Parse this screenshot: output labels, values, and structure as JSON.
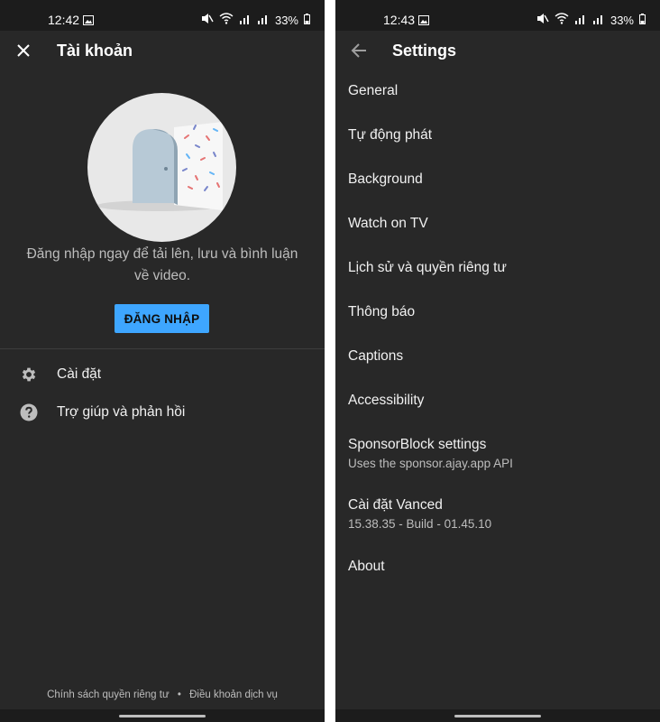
{
  "left": {
    "status": {
      "time": "12:42",
      "battery": "33%"
    },
    "appbar": {
      "title": "Tài khoản",
      "nav_icon": "close-icon"
    },
    "signin": {
      "message": "Đăng nhập ngay để tải lên, lưu và bình luận về video.",
      "button_label": "ĐĂNG NHẬP"
    },
    "menu": [
      {
        "label": "Cài đặt",
        "icon": "gear-icon"
      },
      {
        "label": "Trợ giúp và phản hồi",
        "icon": "help-icon"
      }
    ],
    "footer": {
      "privacy": "Chính sách quyền riêng tư",
      "separator": "•",
      "terms": "Điều khoản dịch vụ"
    }
  },
  "right": {
    "status": {
      "time": "12:43",
      "battery": "33%"
    },
    "appbar": {
      "title": "Settings",
      "nav_icon": "back-arrow-icon"
    },
    "settings": [
      {
        "title": "General"
      },
      {
        "title": "Tự động phát"
      },
      {
        "title": "Background"
      },
      {
        "title": "Watch on TV"
      },
      {
        "title": "Lịch sử và quyền riêng tư"
      },
      {
        "title": "Thông báo"
      },
      {
        "title": "Captions"
      },
      {
        "title": "Accessibility"
      },
      {
        "title": "SponsorBlock settings",
        "subtitle": "Uses the sponsor.ajay.app API"
      },
      {
        "title": "Cài đặt Vanced",
        "subtitle": "15.38.35 - Build - 01.45.10"
      },
      {
        "title": "About"
      }
    ]
  },
  "colors": {
    "background": "#282828",
    "statusbar": "#1c1c1c",
    "accent": "#3ea6ff",
    "text": "#f1f1f1",
    "secondary_text": "#bdbdbd"
  }
}
